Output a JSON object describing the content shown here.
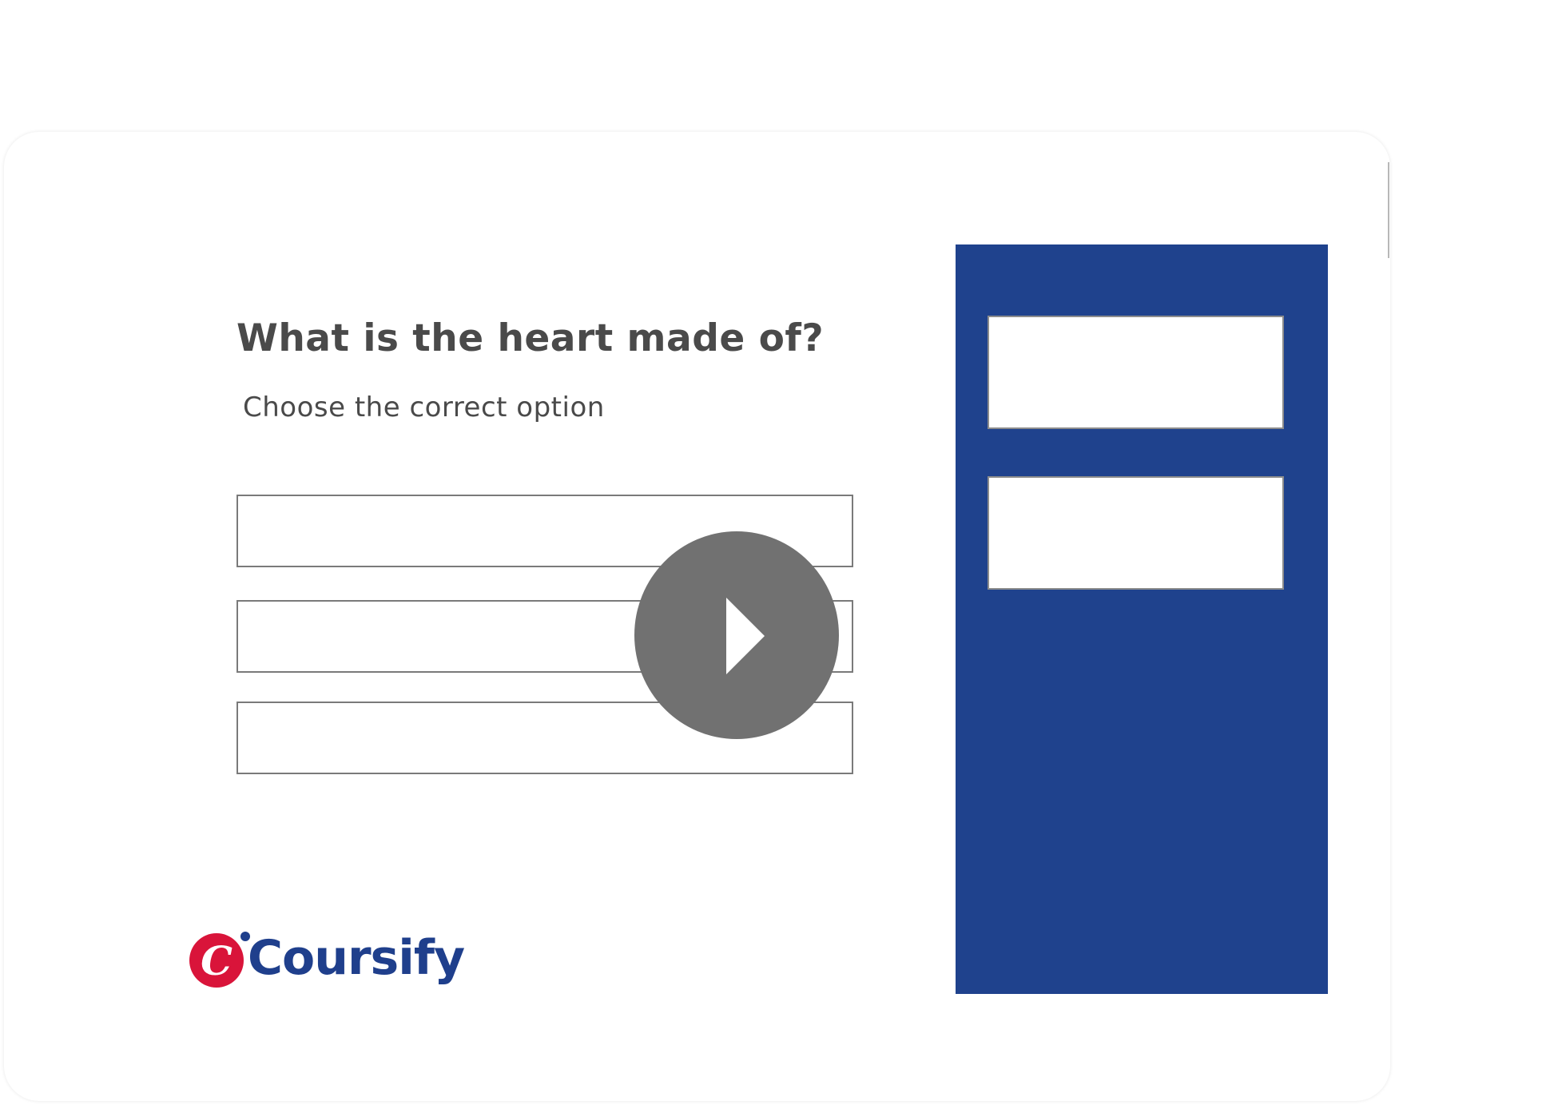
{
  "quiz": {
    "question": "What is the heart made of?",
    "instruction": "Choose the correct option",
    "options": [
      {
        "label": ""
      },
      {
        "label": ""
      },
      {
        "label": ""
      }
    ]
  },
  "side_panel": {
    "background_color": "#1f428d",
    "drop_targets": [
      {
        "label": ""
      },
      {
        "label": ""
      }
    ]
  },
  "media": {
    "play_icon": "play-icon"
  },
  "brand": {
    "name": "Coursify",
    "mark_letter": "C",
    "mark_color": "#d9143a",
    "text_color": "#1f3f8c"
  }
}
